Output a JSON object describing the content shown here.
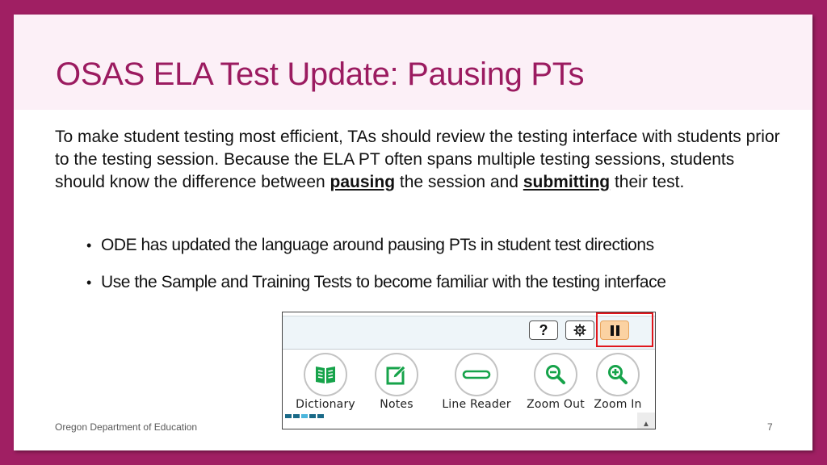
{
  "slide": {
    "title": "OSAS ELA Test Update: Pausing PTs",
    "intro": {
      "part1": "To make student testing most efficient, TAs should review the testing interface with students prior to the testing session. Because the ELA PT often spans multiple testing sessions, students should know the difference between ",
      "emphasis1": "pausing",
      "part2": " the session and ",
      "emphasis2": "submitting",
      "part3": " their test."
    },
    "bullets": [
      {
        "text": "ODE has updated the language around pausing PTs in student test directions"
      },
      {
        "text": "Use the Sample and Training Tests to become familiar with the testing interface"
      }
    ],
    "bullet_glyph": "•",
    "footer": "Oregon Department of Education",
    "page_number": "7"
  },
  "toolbar_screenshot": {
    "top_buttons": [
      {
        "name": "help",
        "icon": "question-mark-icon",
        "glyph": "?"
      },
      {
        "name": "settings",
        "icon": "gear-icon",
        "glyph": "⚙"
      },
      {
        "name": "pause",
        "icon": "pause-icon",
        "highlighted": true
      }
    ],
    "tools": [
      {
        "label": "Dictionary",
        "icon": "book-icon"
      },
      {
        "label": "Notes",
        "icon": "notes-pencil-icon"
      },
      {
        "label": "Line Reader",
        "icon": "line-reader-icon"
      },
      {
        "label": "Zoom Out",
        "icon": "zoom-out-icon"
      },
      {
        "label": "Zoom In",
        "icon": "zoom-in-icon"
      }
    ],
    "scroll_glyph": "▲"
  },
  "colors": {
    "frame": "#a01f63",
    "title": "#9b1b60",
    "title_band": "#fcf0f7",
    "tool_icon_green": "#16a34a",
    "highlight_red": "#e0161c",
    "pause_fill": "#fbd2a2",
    "dots": [
      "#1a6a88",
      "#1a6a88",
      "#4bb6dd",
      "#1a6a88",
      "#1a6a88",
      "#1a6a88"
    ]
  }
}
